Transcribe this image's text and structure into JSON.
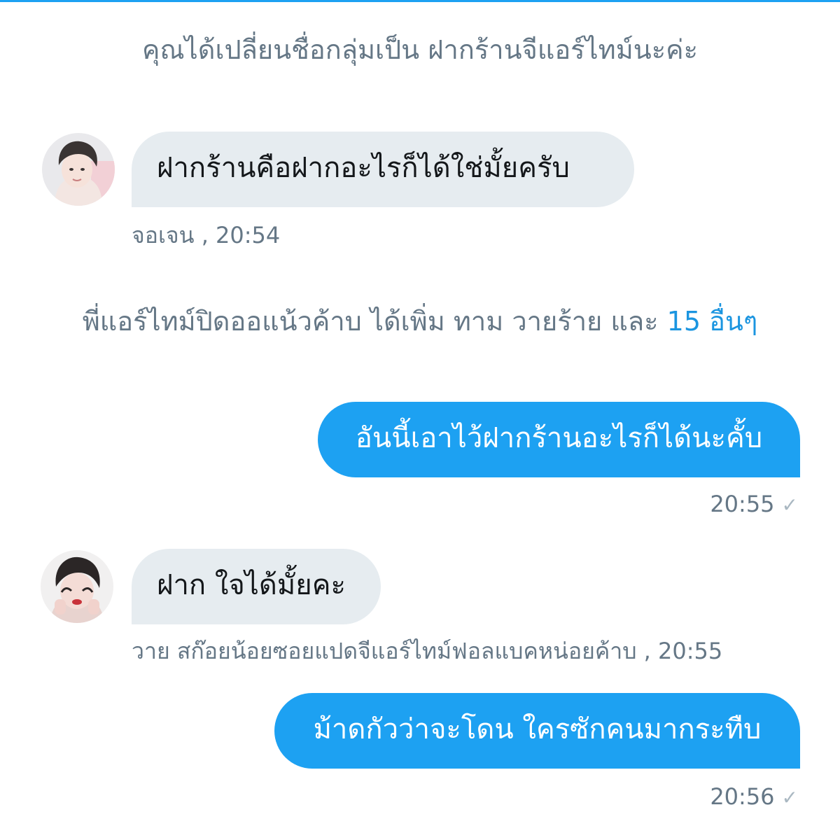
{
  "colors": {
    "accent": "#1da1f2",
    "link": "#1b95e0",
    "incoming_bubble": "#e6ecf0",
    "meta_text": "#657786",
    "top_line": "#1da1f2"
  },
  "system_messages": {
    "rename": "คุณได้เปลี่ยนชื่อกลุ่มเป็น ฝากร้านจีแอร์ไทม์นะค่ะ",
    "join_prefix": "พี่แอร์ไทม์ปิดออแน้วค้าบ ได้เพิ่ม ทาม วายร้าย และ ",
    "join_others": "15 อื่นๆ"
  },
  "messages": [
    {
      "direction": "incoming",
      "text": "ฝากร้านคือฝากอะไรก็ได้ใช่มั้ยครับ",
      "sender": "จอเจน",
      "time": ", 20:54",
      "avatar": "user-avatar"
    },
    {
      "direction": "outgoing",
      "text": "อันนี้เอาไว้ฝากร้านอะไรก็ได้นะคั้บ",
      "time": "20:55",
      "status_icon": "check-icon",
      "status_glyph": "✓"
    },
    {
      "direction": "incoming",
      "text": "ฝาก ใจได้มั้ยคะ",
      "sender": "วาย สก๊อยน้อยซอยแปดจีแอร์ไทม์ฟอลแบคหน่อยค้าบ",
      "time": ", 20:55",
      "avatar": "user-avatar"
    },
    {
      "direction": "outgoing",
      "text": "ม้าดกัวว่าจะโดน ใครซักคนมากระทืบ",
      "time": "20:56",
      "status_icon": "check-icon",
      "status_glyph": "✓"
    }
  ]
}
